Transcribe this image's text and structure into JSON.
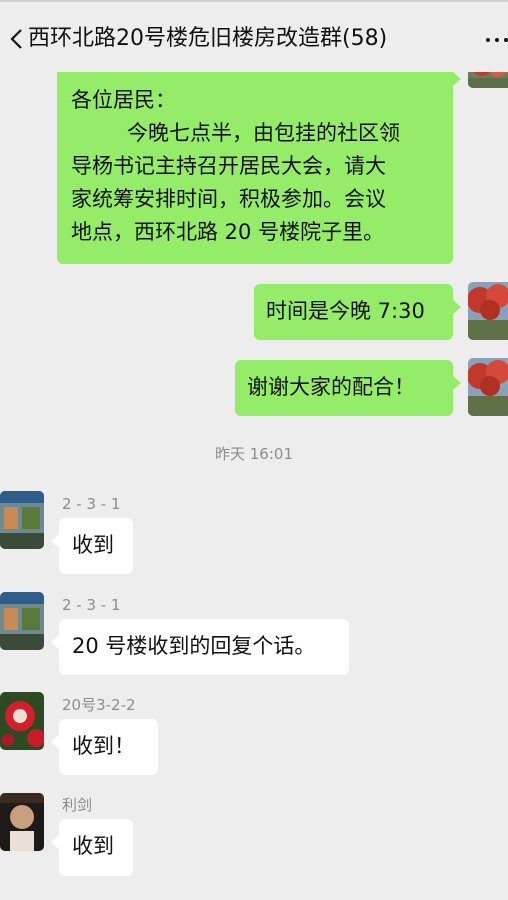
{
  "header": {
    "title": "西环北路20号楼危旧楼房改造群(58)"
  },
  "messages": {
    "notice": {
      "lines": [
        "各位居民：",
        "今晚七点半，由包挂的社区领",
        "导杨书记主持召开居民大会，请大",
        "家统筹安排时间，积极参加。会议",
        "地点，西环北路 20 号楼院子里。"
      ]
    },
    "sent_1": "时间是今晚 7:30",
    "sent_2": "谢谢大家的配合！",
    "timestamp": "昨天 16:01",
    "received": [
      {
        "sender": "2 - 3 - 1",
        "text": "收到"
      },
      {
        "sender": "2 - 3 - 1",
        "text": "20 号楼收到的回复个话。"
      },
      {
        "sender": "20号3-2-2",
        "text": "收到！"
      },
      {
        "sender": "利剑",
        "text": "收到"
      }
    ]
  },
  "colors": {
    "background": "#ededed",
    "sent_bubble": "#95ec69",
    "received_bubble": "#ffffff",
    "meta_text": "#8c8c8c"
  },
  "icons": [
    "back-arrow-icon",
    "more-options-icon"
  ]
}
